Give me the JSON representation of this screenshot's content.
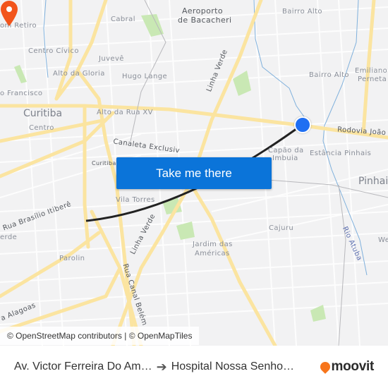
{
  "map": {
    "labels": {
      "bom_retiro": "om Retiro",
      "cabral": "Cabral",
      "aeroporto": "Aeroporto",
      "bacacheri": "de Bacacheri",
      "bairro_alto_top": "Bairro Alto",
      "centro_civico": "Centro Cívico",
      "juveve": "Juvevê",
      "alto_da_gloria": "Alto da Gloria",
      "hugo_lange": "Hugo Lange",
      "bairro_alto_mid": "Bairro Alto",
      "emiliano": "Emiliano",
      "perneta": "Perneta",
      "sao_francisco": "o Francisco",
      "curitiba": "Curitiba",
      "alto_da_rua_xv": "Alto da Rua XV",
      "centro": "Centro",
      "linha_verde_top": "Linha Verde",
      "rodovia": "Rodovia João I",
      "capao_da": "Capão da",
      "imbuia": "Imbuia",
      "estancia_pinhais": "Estância Pinhais",
      "pinhais": "Pinhai",
      "canaleta": "Canaleta Exclusiv",
      "curitiba_small": "Curitiba",
      "vila_torres": "Vila Torres",
      "rua_brasilio": "Rua Brasílio Itiberê",
      "verde_left": "erde",
      "linha_verde_bottom": "Linha Verde",
      "cajuru": "Cajuru",
      "rio_atuba": "Rio Atuba",
      "we": "We",
      "jardim_das": "Jardim das",
      "americas": "Américas",
      "parolin": "Parolin",
      "rua_canal_belem": "Rua Canal Belém",
      "alagoas": "a Alagoas"
    },
    "origin_marker": "origin-marker",
    "destination_marker": "destination-marker",
    "colors": {
      "route": "#222222",
      "origin": "#1f6ff2",
      "destination": "#f2541b",
      "major_road": "#fbe4a0",
      "park": "#c9e8b4",
      "water": "#7fb0dc"
    }
  },
  "cta": {
    "label": "Take me there",
    "color": "#0b74d9"
  },
  "attribution": "© OpenStreetMap contributors | © OpenMapTiles",
  "footer": {
    "from": "Av. Victor Ferreira Do Am…",
    "arrow_icon": "arrow-right-icon",
    "to": "Hospital Nossa Senho…",
    "brand": "moovit",
    "brand_color": "#f7751b"
  }
}
